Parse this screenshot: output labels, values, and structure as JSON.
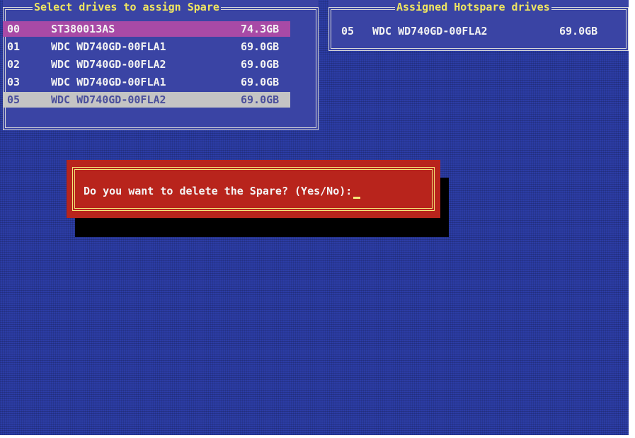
{
  "left_panel": {
    "title": "Select drives to assign Spare",
    "drives": [
      {
        "port": "00",
        "model": "ST380013AS",
        "size": "74.3GB",
        "state": "highlighted"
      },
      {
        "port": "01",
        "model": "WDC WD740GD-00FLA1",
        "size": "69.0GB",
        "state": "normal"
      },
      {
        "port": "02",
        "model": "WDC WD740GD-00FLA2",
        "size": "69.0GB",
        "state": "normal"
      },
      {
        "port": "03",
        "model": "WDC WD740GD-00FLA1",
        "size": "69.0GB",
        "state": "normal"
      },
      {
        "port": "05",
        "model": "WDC WD740GD-00FLA2",
        "size": "69.0GB",
        "state": "selected-spare"
      }
    ]
  },
  "right_panel": {
    "title": "Assigned Hotspare drives",
    "drives": [
      {
        "port": "05",
        "model": "WDC WD740GD-00FLA2",
        "size": "69.0GB"
      }
    ]
  },
  "dialog": {
    "prompt": "Do you want to delete the Spare? (Yes/No):",
    "input_value": ""
  },
  "colors": {
    "background": "#2c3da6",
    "panel": "#3a44a4",
    "title_text": "#f0e660",
    "highlight_row": "#a84aa6",
    "selected_row": "#c4c4c4",
    "dialog": "#b8241c",
    "dialog_border": "#f4e87a"
  }
}
